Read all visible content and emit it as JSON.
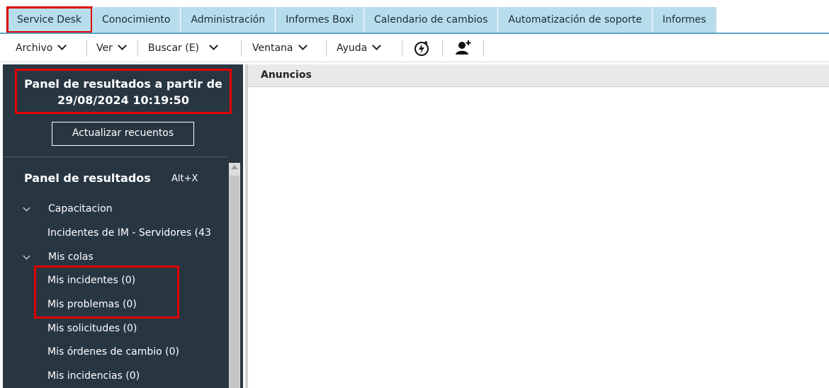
{
  "tabs": [
    {
      "label": "Service Desk",
      "active": true
    },
    {
      "label": "Conocimiento"
    },
    {
      "label": "Administración"
    },
    {
      "label": "Informes Boxi"
    },
    {
      "label": "Calendario de cambios"
    },
    {
      "label": "Automatización de soporte"
    },
    {
      "label": "Informes"
    }
  ],
  "menu": {
    "archivo": "Archivo",
    "ver": "Ver",
    "buscar": "Buscar (E)",
    "ventana": "Ventana",
    "ayuda": "Ayuda",
    "icons": [
      "lightning-circle-icon",
      "add-user-icon"
    ]
  },
  "sidebar": {
    "header_line1": "Panel de resultados a partir de",
    "header_line2": "29/08/2024 10:19:50",
    "refresh_button": "Actualizar recuentos",
    "panel_title": "Panel de resultados",
    "shortcut": "Alt+X",
    "groups": [
      {
        "label": "Capacitacion",
        "items": [
          "Incidentes de IM - Servidores (43"
        ]
      },
      {
        "label": "Mis colas",
        "items": [
          "Mis incidentes (0)",
          "Mis problemas (0)",
          "Mis solicitudes (0)",
          "Mis órdenes de cambio (0)",
          "Mis incidencias (0)"
        ]
      }
    ]
  },
  "content": {
    "title": "Anuncios"
  },
  "colors": {
    "tab_bg": "#b7ddec",
    "sidebar_bg": "#283642",
    "highlight": "#e00000",
    "accent_line": "#5ba3c8"
  }
}
